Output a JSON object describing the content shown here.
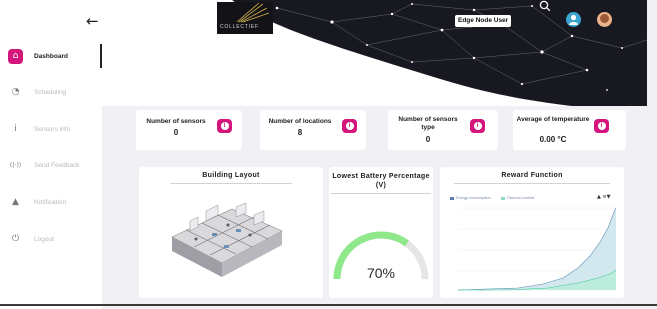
{
  "header": {
    "logo_text": "COLLECTIEF",
    "user_badge": "Edge Node User"
  },
  "sidebar": {
    "items": [
      {
        "label": "Dashboard",
        "icon": "home-icon",
        "glyph": "⌂",
        "active": true
      },
      {
        "label": "Scheduling",
        "icon": "clock-icon",
        "glyph": "◔",
        "active": false
      },
      {
        "label": "Sensors info",
        "icon": "info-icon",
        "glyph": "i",
        "active": false
      },
      {
        "label": "Send Feedback",
        "icon": "broadcast-icon",
        "glyph": "((·))",
        "active": false
      },
      {
        "label": "Notification",
        "icon": "warning-icon",
        "glyph": "▲",
        "active": false
      },
      {
        "label": "Logout",
        "icon": "power-icon",
        "glyph": "⏻",
        "active": false
      }
    ]
  },
  "stats": [
    {
      "label": "Number of sensors",
      "value": "0"
    },
    {
      "label": "Number of locations",
      "value": "8"
    },
    {
      "label": "Number of sensors type",
      "value": "0"
    },
    {
      "label": "Average of temperature",
      "value": "0.00 °C"
    }
  ],
  "panels": {
    "building_title": "Building Layout",
    "battery_title": "Lowest Battery Percentage (V)",
    "battery_value": "70%",
    "battery_fraction": 0.7,
    "reward_title": "Reward Function",
    "reward_legend": [
      "Energy consumption",
      "Thermal comfort"
    ]
  },
  "colors": {
    "accent": "#d4157c",
    "gauge": "#8fe88a",
    "gauge_track": "#e6e6e6"
  }
}
